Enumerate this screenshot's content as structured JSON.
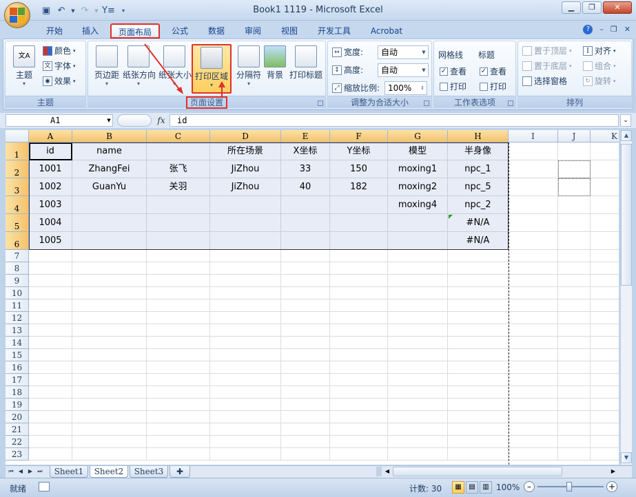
{
  "window": {
    "title": "Book1 1119 - Microsoft Excel"
  },
  "tabs": [
    {
      "label": "开始"
    },
    {
      "label": "插入"
    },
    {
      "label": "页面布局"
    },
    {
      "label": "公式"
    },
    {
      "label": "数据"
    },
    {
      "label": "审阅"
    },
    {
      "label": "视图"
    },
    {
      "label": "开发工具"
    },
    {
      "label": "Acrobat"
    }
  ],
  "ribbon": {
    "theme_group": {
      "label": "主题",
      "themes": "主题",
      "colors": "颜色",
      "fonts": "字体",
      "effects": "效果"
    },
    "page_setup": {
      "label": "页面设置",
      "margins": "页边距",
      "orientation": "纸张方向",
      "size": "纸张大小",
      "print_area": "打印区域",
      "breaks": "分隔符",
      "background": "背景",
      "print_titles": "打印标题"
    },
    "scale": {
      "label": "调整为合适大小",
      "width_label": "宽度:",
      "width_value": "自动",
      "height_label": "高度:",
      "height_value": "自动",
      "scale_label": "缩放比例:",
      "scale_value": "100%"
    },
    "sheet_options": {
      "label": "工作表选项",
      "gridlines": "网格线",
      "headings": "标题",
      "view": "查看",
      "print": "打印"
    },
    "arrange": {
      "label": "排列",
      "bring_front": "置于顶层",
      "send_back": "置于底层",
      "selection_pane": "选择窗格",
      "align": "对齐",
      "group": "组合",
      "rotate": "旋转"
    }
  },
  "formula_bar": {
    "name_box": "A1",
    "fx": "fx",
    "content": "id"
  },
  "columns": [
    "A",
    "B",
    "C",
    "D",
    "E",
    "F",
    "G",
    "H",
    "I",
    "J",
    "K"
  ],
  "rows": [
    "1",
    "2",
    "3",
    "4",
    "5",
    "6",
    "7",
    "8",
    "9",
    "10",
    "11",
    "12",
    "13",
    "14",
    "15",
    "16",
    "17",
    "18",
    "19",
    "20",
    "21",
    "22",
    "23"
  ],
  "cells": [
    [
      "id",
      "name",
      "",
      "所在场景",
      "X坐标",
      "Y坐标",
      "模型",
      "半身像"
    ],
    [
      "1001",
      "ZhangFei",
      "张飞",
      "JiZhou",
      "33",
      "150",
      "moxing1",
      "npc_1"
    ],
    [
      "1002",
      "GuanYu",
      "关羽",
      "JiZhou",
      "40",
      "182",
      "moxing2",
      "npc_5"
    ],
    [
      "1003",
      "",
      "",
      "",
      "",
      "",
      "moxing4",
      "npc_2"
    ],
    [
      "1004",
      "",
      "",
      "",
      "",
      "",
      "",
      "#N/A"
    ],
    [
      "1005",
      "",
      "",
      "",
      "",
      "",
      "",
      "#N/A"
    ]
  ],
  "sheets": [
    "Sheet1",
    "Sheet2",
    "Sheet3"
  ],
  "status": {
    "mode": "就绪",
    "count": "计数: 30",
    "zoom": "100%"
  }
}
